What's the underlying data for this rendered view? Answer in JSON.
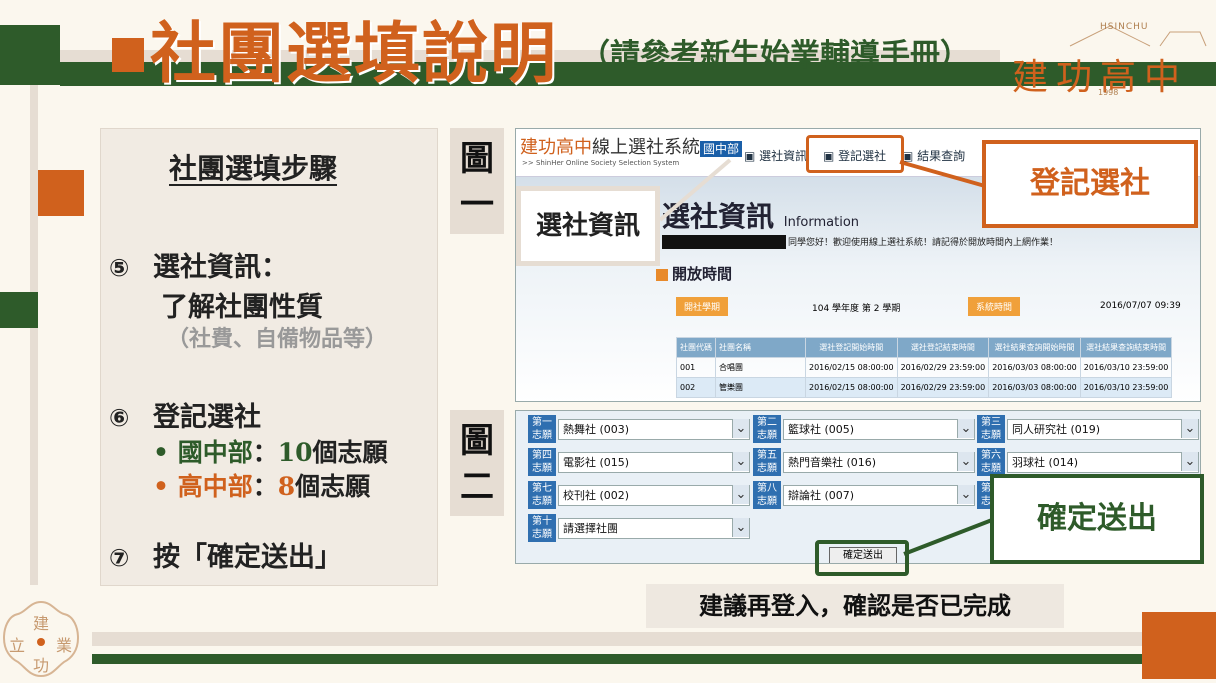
{
  "header": {
    "title": "社團選填說明",
    "subtitle": "（請參考新生始業輔導手冊）"
  },
  "logo": {
    "romanized": "HSINCHU",
    "name": "建功高中",
    "year": "1998"
  },
  "steps_panel": {
    "heading": "社團選填步驟",
    "step5": {
      "num": "⑤",
      "title": "選社資訊：",
      "detail": "了解社團性質",
      "note": "（社費、自備物品等）"
    },
    "step6": {
      "num": "⑥",
      "title": "登記選社",
      "junior": {
        "dept": "國中部",
        "sep": "：",
        "count": "10",
        "unit": "個志願"
      },
      "senior": {
        "dept": "高中部",
        "sep": "：",
        "count": "8",
        "unit": "個志願"
      }
    },
    "step7": {
      "num": "⑦",
      "title": "按「確定送出」"
    }
  },
  "figures": {
    "fig1": "圖一",
    "fig2": "圖二"
  },
  "screenshot1": {
    "brand": "建功高中",
    "brand_rest": "線上選社系統",
    "dept_tag": "國中部",
    "english": ">> ShinHer Online Society Selection System",
    "nav": [
      "選社資訊",
      "登記選社",
      "結果查詢"
    ],
    "info_title": "選社資訊",
    "info_en": "Information",
    "greeting": "同學您好！歡迎使用線上選社系統！請記得於開放時間內上網作業！",
    "open_time": "開放時間",
    "term_label": "開社學期",
    "term_value": "104 學年度 第 2 學期",
    "systime_label": "系統時間",
    "systime_value": "2016/07/07 09:39",
    "table_headers": [
      "社團代碼",
      "社團名稱",
      "選社登記開始時間",
      "選社登記結束時間",
      "選社結果查詢開始時間",
      "選社結果查詢結束時間"
    ],
    "table_rows": [
      [
        "001",
        "合唱團",
        "2016/02/15 08:00:00",
        "2016/02/29 23:59:00",
        "2016/03/03 08:00:00",
        "2016/03/10 23:59:00"
      ],
      [
        "002",
        "管樂團",
        "2016/02/15 08:00:00",
        "2016/02/29 23:59:00",
        "2016/03/03 08:00:00",
        "2016/03/10 23:59:00"
      ]
    ]
  },
  "callouts": {
    "info": "選社資訊",
    "register": "登記選社",
    "confirm": "確定送出"
  },
  "screenshot2": {
    "choices": [
      {
        "tag1": "第一",
        "tag2": "志願",
        "value": "熱舞社 (003)"
      },
      {
        "tag1": "第二",
        "tag2": "志願",
        "value": "籃球社 (005)"
      },
      {
        "tag1": "第三",
        "tag2": "志願",
        "value": "同人研究社 (019)"
      },
      {
        "tag1": "第四",
        "tag2": "志願",
        "value": "電影社 (015)"
      },
      {
        "tag1": "第五",
        "tag2": "志願",
        "value": "熱門音樂社 (016)"
      },
      {
        "tag1": "第六",
        "tag2": "志願",
        "value": "羽球社 (014)"
      },
      {
        "tag1": "第七",
        "tag2": "志願",
        "value": "校刊社 (002)"
      },
      {
        "tag1": "第八",
        "tag2": "志願",
        "value": "辯論社 (007)"
      },
      {
        "tag1": "第九",
        "tag2": "志願",
        "value": ""
      },
      {
        "tag1": "第十",
        "tag2": "志願",
        "value": "請選擇社團"
      }
    ],
    "submit": "確定送出"
  },
  "note": "建議再登入，確認是否已完成",
  "seal": [
    "建",
    "立",
    "業",
    "功"
  ],
  "colors": {
    "orange": "#d0611d",
    "green": "#2e5b2a",
    "beige": "#e6ddd3"
  }
}
